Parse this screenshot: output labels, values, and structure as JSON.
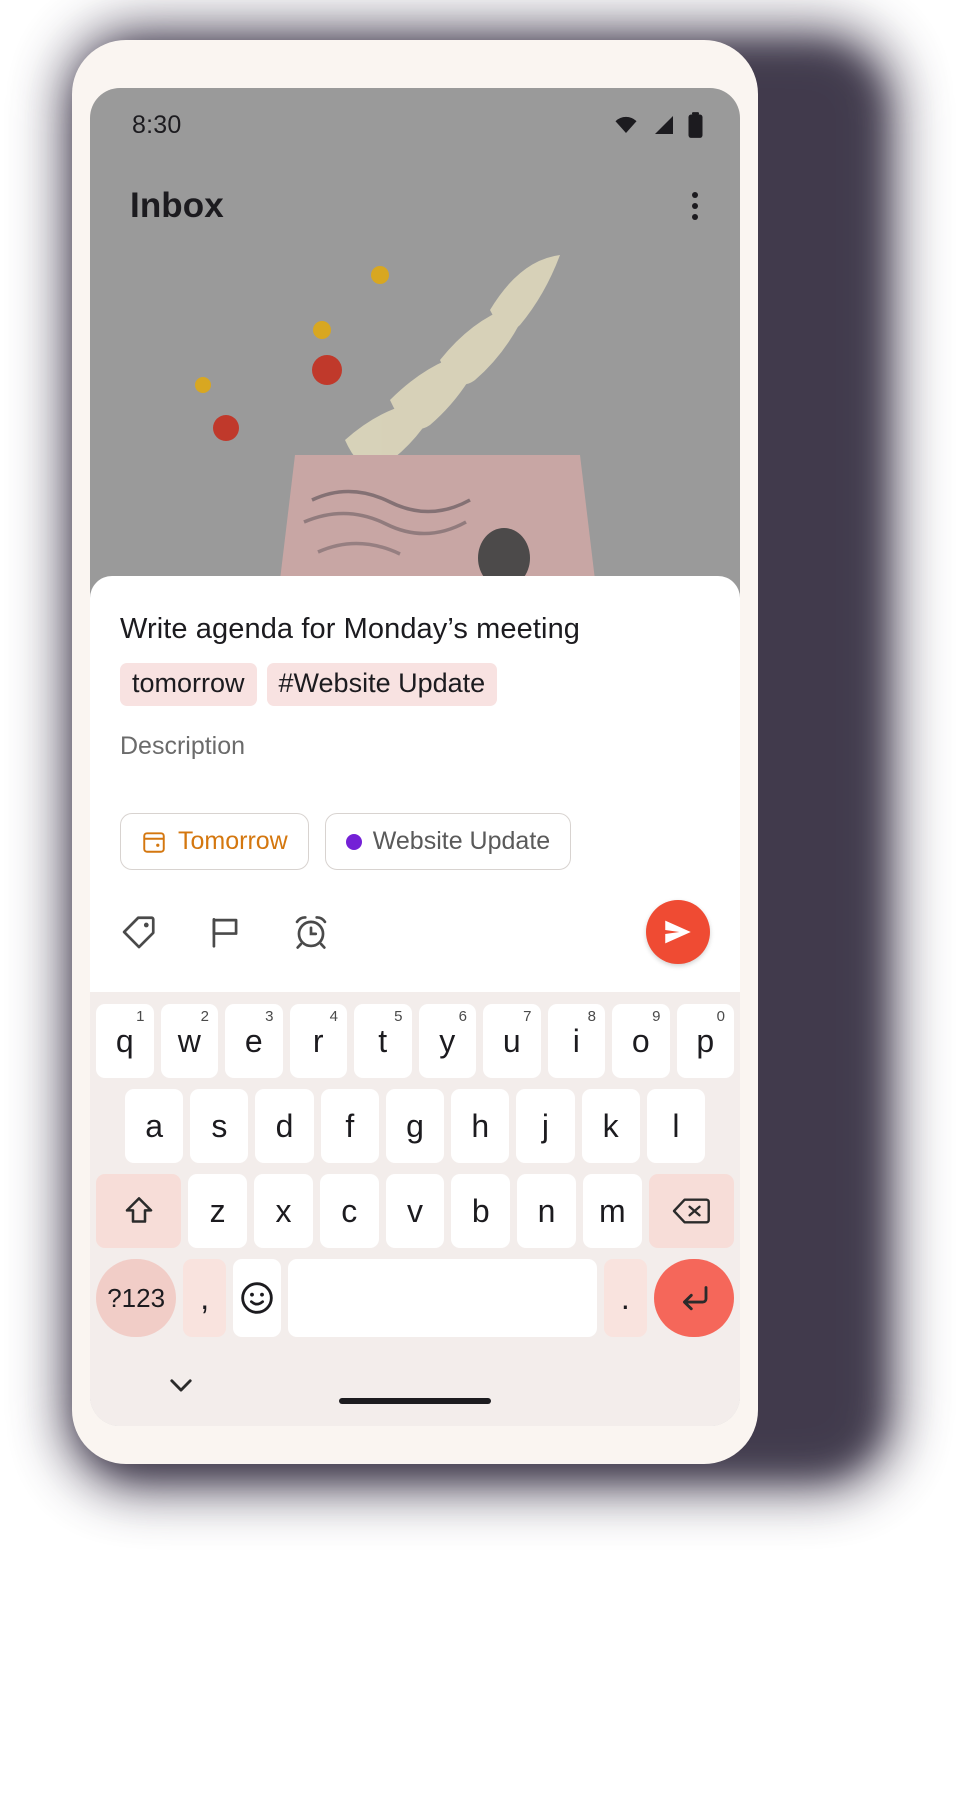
{
  "status_bar": {
    "time": "8:30",
    "icons": [
      "wifi-icon",
      "cellular-signal-icon",
      "battery-icon"
    ]
  },
  "app_bar": {
    "title": "Inbox",
    "overflow_menu": "more-options"
  },
  "illustration": {
    "name": "inbox-empty-illustration",
    "colors": {
      "background": "#9a9a9a",
      "box": "#c8a6a4",
      "paper": "#ded8bc",
      "dot_red": "#c0392b",
      "dot_yellow": "#d8a721"
    }
  },
  "task_sheet": {
    "title": "Write agenda for Monday’s meeting",
    "inline_chips": [
      {
        "label": "tomorrow"
      },
      {
        "label": "#Website Update"
      }
    ],
    "description_placeholder": "Description",
    "attribute_chips": [
      {
        "label": "Tomorrow",
        "icon": "calendar-icon",
        "color": "#d4770f"
      },
      {
        "label": "Website Update",
        "icon": "project-dot-icon",
        "color": "#7421d6"
      }
    ],
    "actions": [
      {
        "name": "label-tag-icon"
      },
      {
        "name": "flag-priority-icon"
      },
      {
        "name": "alarm-reminder-icon"
      }
    ],
    "send_button": {
      "icon": "send-icon",
      "color": "#ef4b33"
    }
  },
  "keyboard": {
    "row1": [
      {
        "key": "q",
        "num": "1"
      },
      {
        "key": "w",
        "num": "2"
      },
      {
        "key": "e",
        "num": "3"
      },
      {
        "key": "r",
        "num": "4"
      },
      {
        "key": "t",
        "num": "5"
      },
      {
        "key": "y",
        "num": "6"
      },
      {
        "key": "u",
        "num": "7"
      },
      {
        "key": "i",
        "num": "8"
      },
      {
        "key": "o",
        "num": "9"
      },
      {
        "key": "p",
        "num": "0"
      }
    ],
    "row2": [
      "a",
      "s",
      "d",
      "f",
      "g",
      "h",
      "j",
      "k",
      "l"
    ],
    "row3": [
      "z",
      "x",
      "c",
      "v",
      "b",
      "n",
      "m"
    ],
    "shift_key": "shift-icon",
    "backspace_key": "backspace-icon",
    "symbols_key": "?123",
    "comma_key": ",",
    "emoji_key": "emoji-icon",
    "space_key": "",
    "period_key": ".",
    "enter_key": "enter-icon",
    "hide_keyboard": "chevron-down-icon"
  }
}
